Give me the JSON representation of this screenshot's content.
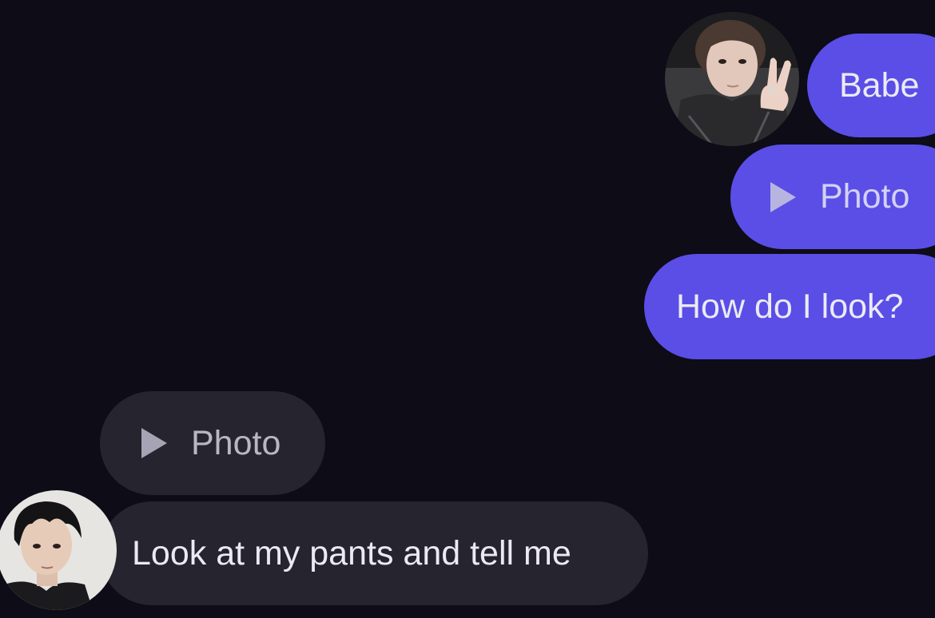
{
  "colors": {
    "background": "#0d0c17",
    "outgoing_bubble": "#5a4ee6",
    "incoming_bubble": "#26242f",
    "text": "#ebeaf4"
  },
  "outgoing": {
    "messages": [
      {
        "type": "text",
        "text": "Babe"
      },
      {
        "type": "photo",
        "icon": "play-icon",
        "label": "Photo"
      },
      {
        "type": "text",
        "text": "How do I look?"
      }
    ]
  },
  "incoming": {
    "messages": [
      {
        "type": "photo",
        "icon": "play-icon",
        "label": "Photo"
      },
      {
        "type": "text",
        "text": "Look at my pants and tell me"
      }
    ]
  }
}
